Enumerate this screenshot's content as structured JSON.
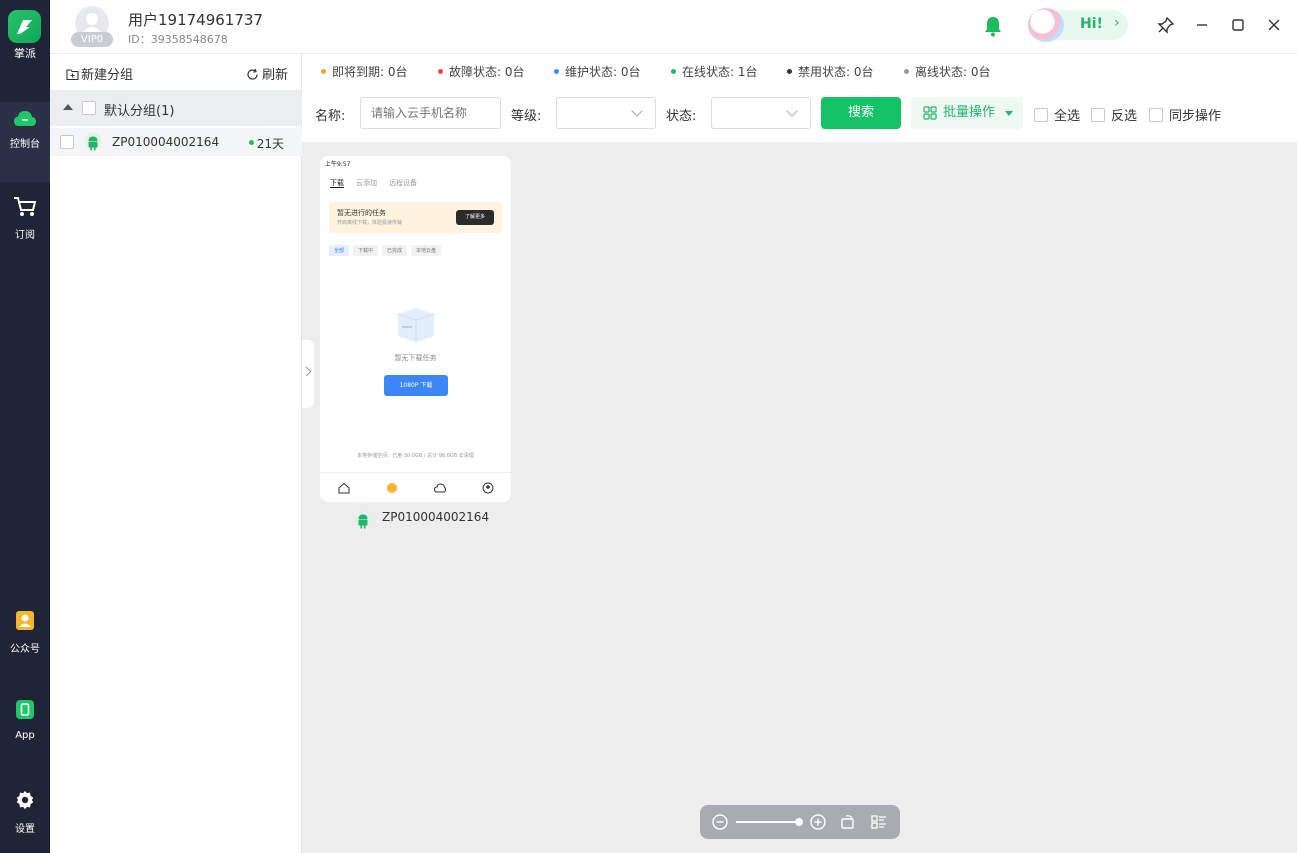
{
  "app": {
    "name": "掌派",
    "brand_color": "#13c365"
  },
  "rail": {
    "items": [
      {
        "label": "控制台",
        "icon": "cloud-icon",
        "active": true
      },
      {
        "label": "订阅",
        "icon": "cart-icon",
        "active": false
      },
      {
        "label": "公众号",
        "icon": "user-card-icon",
        "active": false
      },
      {
        "label": "App",
        "icon": "phone-icon",
        "active": false
      },
      {
        "label": "设置",
        "icon": "gear-icon",
        "active": false
      }
    ]
  },
  "header": {
    "vip": "VIP0",
    "user_name": "用户19174961737",
    "user_id": "ID：39358548678",
    "hi": "Hi!",
    "hi_arrow": "›"
  },
  "groups": {
    "new_group": "新建分组",
    "refresh": "刷新",
    "default_group": "默认分组(1)",
    "device_name": "ZP010004002164",
    "device_days": "21天"
  },
  "status": [
    {
      "label": "即将到期: 0台",
      "color": "#f0a23b"
    },
    {
      "label": "故障状态: 0台",
      "color": "#e8483f"
    },
    {
      "label": "维护状态: 0台",
      "color": "#3b8ff0"
    },
    {
      "label": "在线状态: 1台",
      "color": "#1fbb5f"
    },
    {
      "label": "禁用状态: 0台",
      "color": "#2d3444"
    },
    {
      "label": "离线状态: 0台",
      "color": "#999999"
    }
  ],
  "filters": {
    "name_label": "名称:",
    "name_placeholder": "请输入云手机名称",
    "level_label": "等级:",
    "state_label": "状态:",
    "search": "搜索",
    "batch": "批量操作",
    "select_all": "全选",
    "invert": "反选",
    "sync": "同步操作"
  },
  "phone": {
    "status_time": "上午9:57",
    "tabs": [
      "下载",
      "云添加",
      "远程设备"
    ],
    "banner_title": "暂无进行的任务",
    "banner_sub": "开启离线下载，体验极速传输",
    "banner_btn": "了解更多",
    "chips": [
      "全部",
      "下载中",
      "已完成",
      "本地云盘"
    ],
    "empty_text": "暂无下载任务",
    "download_btn": "1080P 下载",
    "footer": "本地存储空间：已用 30.0GB / 总计 98.0GB 去清理",
    "caption": "ZP010004002164"
  }
}
